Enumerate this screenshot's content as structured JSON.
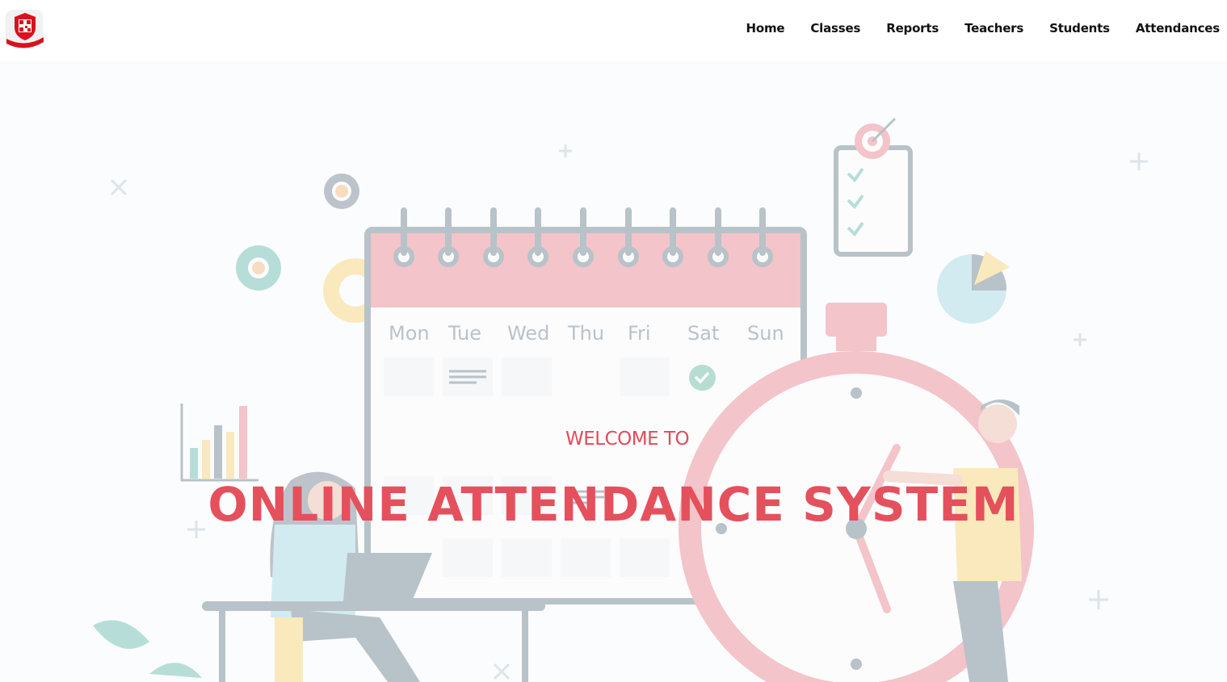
{
  "nav": {
    "logo_icon": "qr-shield-icon",
    "links": [
      "Home",
      "Classes",
      "Reports",
      "Teachers",
      "Students",
      "Attendances"
    ]
  },
  "hero": {
    "welcome": "WELCOME TO",
    "title": "ONLINE ATTENDANCE SYSTEM",
    "calendar_days": [
      "Mon",
      "Tue",
      "Wed",
      "Thu",
      "Fri",
      "Sat",
      "Sun"
    ]
  },
  "colors": {
    "accent": "#e5505d",
    "nav_text": "#111111",
    "background": "#ffffff"
  }
}
